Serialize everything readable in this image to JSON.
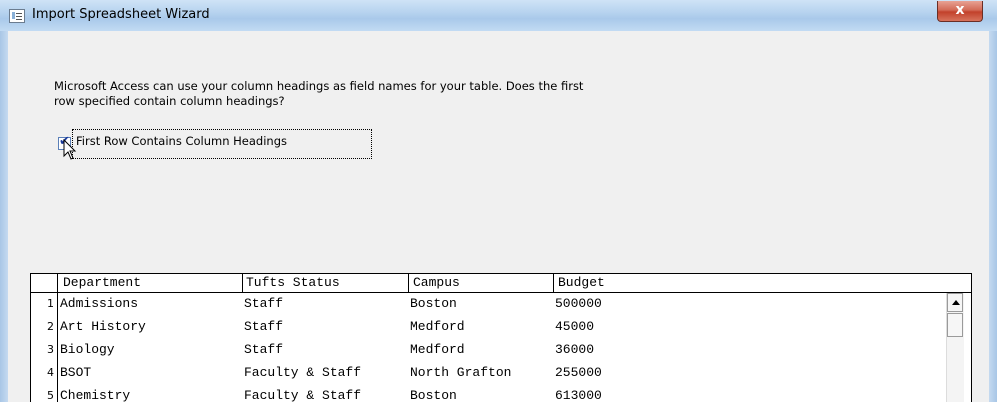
{
  "window": {
    "title": "Import Spreadsheet Wizard",
    "close_label": "x",
    "icon": "spreadsheet-wizard-icon"
  },
  "prompt": {
    "line1": "Microsoft Access can use your column headings as field names for your table. Does the first",
    "line2": "row specified contain column headings?"
  },
  "checkbox": {
    "label": "First Row Contains Column Headings",
    "checked": true,
    "check_glyph": "✔"
  },
  "grid": {
    "columns": [
      "Department",
      "Tufts Status",
      "Campus",
      "Budget"
    ],
    "rows": [
      {
        "num": "1",
        "cells": [
          "Admissions",
          "Staff",
          "Boston",
          "500000"
        ]
      },
      {
        "num": "2",
        "cells": [
          "Art History",
          "Staff",
          "Medford",
          "45000"
        ]
      },
      {
        "num": "3",
        "cells": [
          "Biology",
          "Staff",
          "Medford",
          "36000"
        ]
      },
      {
        "num": "4",
        "cells": [
          "BSOT",
          "Faculty & Staff",
          "North Grafton",
          "255000"
        ]
      },
      {
        "num": "5",
        "cells": [
          "Chemistry",
          "Faculty & Staff",
          "Boston",
          "613000"
        ]
      }
    ]
  },
  "colors": {
    "titlebar": "#b7d3ef",
    "close_button": "#c2412b",
    "dialog_background": "#f0f0f0"
  }
}
